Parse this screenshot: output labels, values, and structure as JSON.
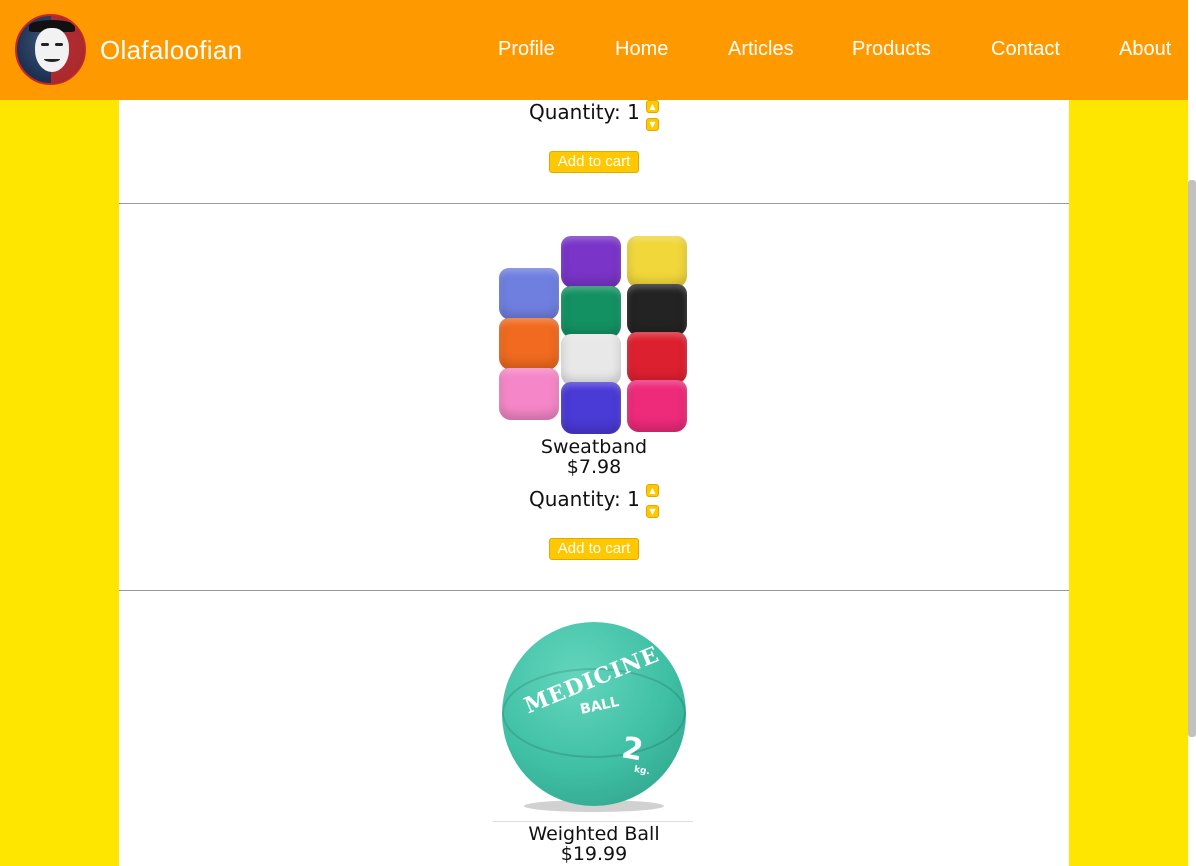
{
  "header": {
    "site_name": "Olafaloofian",
    "nav": [
      "Profile",
      "Home",
      "Articles",
      "Products",
      "Contact",
      "About"
    ]
  },
  "products": [
    {
      "name": "",
      "price": "",
      "quantity_label": "Quantity: 1",
      "add_label": "Add to cart"
    },
    {
      "name": "Sweatband",
      "price": "$7.98",
      "quantity_label": "Quantity: 1",
      "add_label": "Add to cart"
    },
    {
      "name": "Weighted Ball",
      "price": "$19.99"
    }
  ],
  "ball_image": {
    "line1": "MEDICINE",
    "line2": "BALL",
    "weight": "2",
    "unit": "kg."
  },
  "colors": {
    "page_bg": "#FFE600",
    "header_bg": "#FF9900",
    "button": "#FFC800"
  }
}
